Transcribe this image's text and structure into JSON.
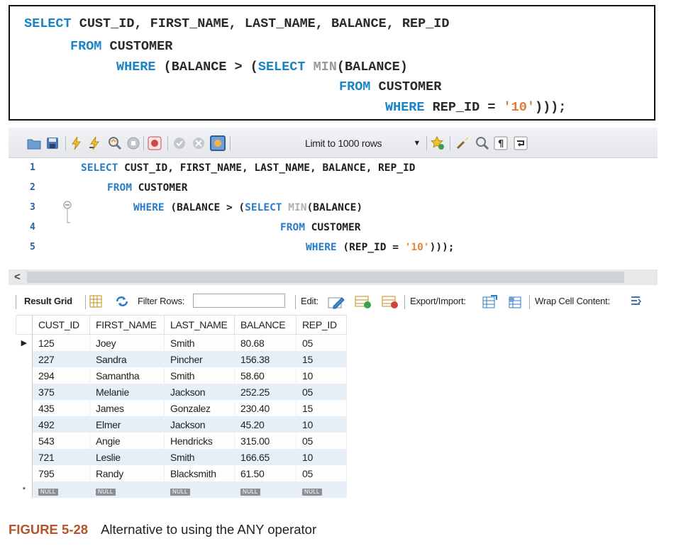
{
  "code_box": {
    "lines": [
      [
        {
          "t": "SELECT",
          "c": "kw"
        },
        {
          "t": " CUST_ID, FIRST_NAME, LAST_NAME, BALANCE, REP_ID",
          "c": ""
        }
      ],
      [
        {
          "t": "FROM",
          "c": "kw"
        },
        {
          "t": " CUSTOMER",
          "c": ""
        }
      ],
      [
        {
          "t": "WHERE",
          "c": "kw"
        },
        {
          "t": " (BALANCE > (",
          "c": ""
        },
        {
          "t": "SELECT",
          "c": "kw"
        },
        {
          "t": " ",
          "c": ""
        },
        {
          "t": "MIN",
          "c": "fn"
        },
        {
          "t": "(BALANCE)",
          "c": ""
        }
      ],
      [
        {
          "t": "FROM",
          "c": "kw"
        },
        {
          "t": " CUSTOMER",
          "c": ""
        }
      ],
      [
        {
          "t": "WHERE",
          "c": "kw"
        },
        {
          "t": " REP_ID = ",
          "c": ""
        },
        {
          "t": "'10'",
          "c": "str"
        },
        {
          "t": ")));",
          "c": ""
        }
      ]
    ]
  },
  "toolbar": {
    "limit_label": "Limit to 1000 rows",
    "icons": [
      "folder-icon",
      "save-icon",
      "execute-icon",
      "execute-current-icon",
      "explain-icon",
      "stop-icon",
      "toggle-continue-icon",
      "commit-icon",
      "rollback-icon",
      "autocommit-icon",
      "beautify-icon",
      "brush-icon",
      "find-icon",
      "invisible-chars-icon",
      "wrap-icon"
    ]
  },
  "editor": {
    "line_numbers": [
      "1",
      "2",
      "3",
      "4",
      "5"
    ],
    "lines": [
      [
        {
          "t": "SELECT",
          "c": "kw"
        },
        {
          "t": " CUST_ID, FIRST_NAME, LAST_NAME, BALANCE, REP_ID",
          "c": ""
        }
      ],
      [
        {
          "t": "FROM",
          "c": "kw"
        },
        {
          "t": " CUSTOMER",
          "c": ""
        }
      ],
      [
        {
          "t": "WHERE",
          "c": "kw"
        },
        {
          "t": " (BALANCE > (",
          "c": ""
        },
        {
          "t": "SELECT",
          "c": "kw"
        },
        {
          "t": " ",
          "c": ""
        },
        {
          "t": "MIN",
          "c": "fn"
        },
        {
          "t": "(BALANCE)",
          "c": ""
        }
      ],
      [
        {
          "t": "FROM",
          "c": "kw"
        },
        {
          "t": " CUSTOMER",
          "c": ""
        }
      ],
      [
        {
          "t": "WHERE",
          "c": "kw"
        },
        {
          "t": " (REP_ID = ",
          "c": ""
        },
        {
          "t": "'10'",
          "c": "str"
        },
        {
          "t": ")));",
          "c": ""
        }
      ]
    ]
  },
  "result_bar": {
    "result_grid": "Result Grid",
    "filter_rows": "Filter Rows:",
    "filter_value": "",
    "edit": "Edit:",
    "export_import": "Export/Import:",
    "wrap_cell": "Wrap Cell Content:"
  },
  "grid": {
    "columns": [
      "CUST_ID",
      "FIRST_NAME",
      "LAST_NAME",
      "BALANCE",
      "REP_ID"
    ],
    "rows": [
      [
        "125",
        "Joey",
        "Smith",
        "80.68",
        "05"
      ],
      [
        "227",
        "Sandra",
        "Pincher",
        "156.38",
        "15"
      ],
      [
        "294",
        "Samantha",
        "Smith",
        "58.60",
        "10"
      ],
      [
        "375",
        "Melanie",
        "Jackson",
        "252.25",
        "05"
      ],
      [
        "435",
        "James",
        "Gonzalez",
        "230.40",
        "15"
      ],
      [
        "492",
        "Elmer",
        "Jackson",
        "45.20",
        "10"
      ],
      [
        "543",
        "Angie",
        "Hendricks",
        "315.00",
        "05"
      ],
      [
        "721",
        "Leslie",
        "Smith",
        "166.65",
        "10"
      ],
      [
        "795",
        "Randy",
        "Blacksmith",
        "61.50",
        "05"
      ]
    ],
    "null_label": "NULL",
    "current_row_marker": "▶",
    "new_row_marker": "*"
  },
  "caption": {
    "figure_number": "FIGURE 5-28",
    "text": "Alternative to using the ANY operator"
  }
}
